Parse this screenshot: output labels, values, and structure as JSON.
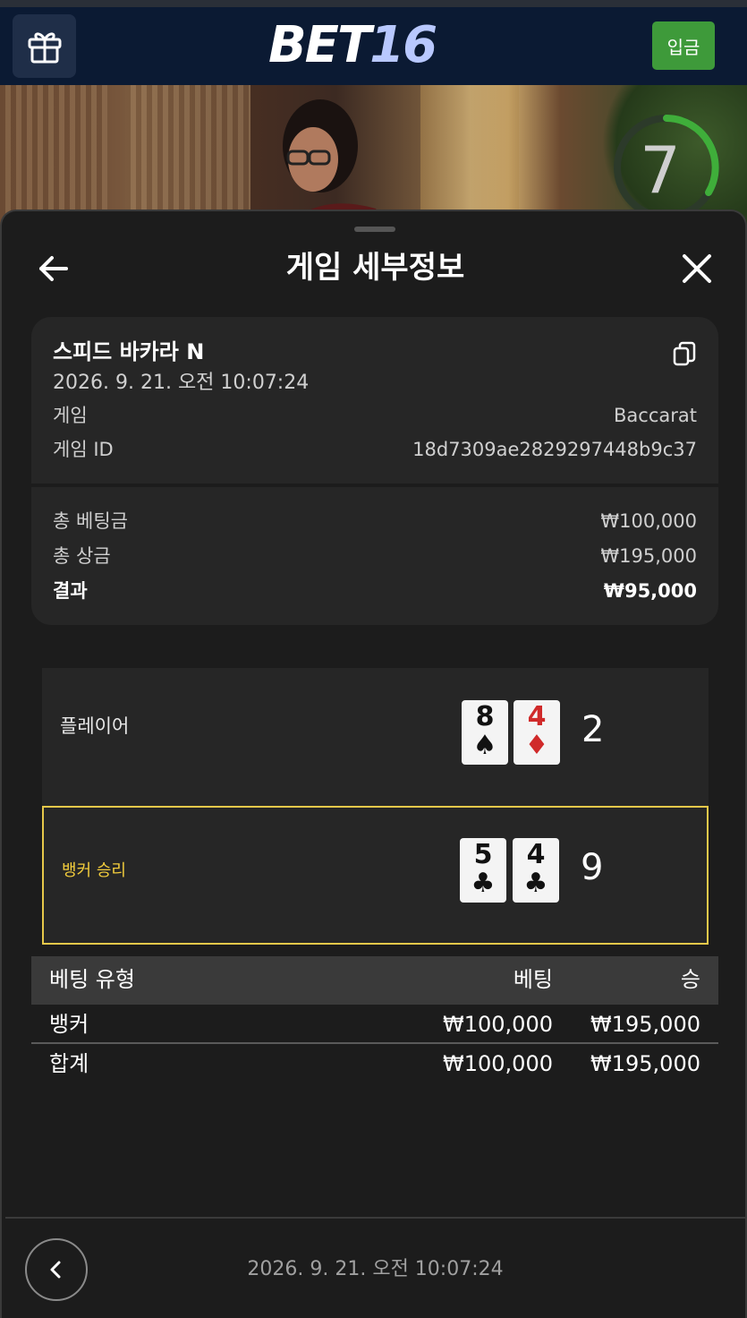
{
  "header": {
    "logo_part1": "BET",
    "logo_part2": "16",
    "deposit_label": "입금"
  },
  "stream": {
    "timer_value": "7",
    "timer_progress": 0.45
  },
  "sheet": {
    "title": "게임 세부정보"
  },
  "game": {
    "name": "스피드 바카라 N",
    "datetime": "2026. 9. 21. 오전 10:07:24",
    "type_label": "게임",
    "type_value": "Baccarat",
    "id_label": "게임 ID",
    "id_value": "18d7309ae2829297448b9c37"
  },
  "summary": {
    "total_bet_label": "총 베팅금",
    "total_bet_value": "₩100,000",
    "total_win_label": "총 상금",
    "total_win_value": "₩195,000",
    "result_label": "결과",
    "result_value": "₩95,000"
  },
  "hands": {
    "player": {
      "label": "플레이어",
      "cards": [
        {
          "rank": "8",
          "suit": "♠",
          "color": "#111111"
        },
        {
          "rank": "4",
          "suit": "♦",
          "color": "#d02a2a"
        }
      ],
      "score": "2"
    },
    "banker": {
      "label": "뱅커 승리",
      "cards": [
        {
          "rank": "5",
          "suit": "♣",
          "color": "#111111"
        },
        {
          "rank": "4",
          "suit": "♣",
          "color": "#111111"
        }
      ],
      "score": "9"
    }
  },
  "bets_table": {
    "headers": [
      "베팅 유형",
      "베팅",
      "승"
    ],
    "rows": [
      [
        "뱅커",
        "₩100,000",
        "₩195,000"
      ],
      [
        "합계",
        "₩100,000",
        "₩195,000"
      ]
    ]
  },
  "footer": {
    "datetime": "2026. 9. 21. 오전 10:07:24"
  },
  "colors": {
    "header_bg": "#0b1a33",
    "deposit_green": "#3e9a3a",
    "banker_highlight": "#e6c84a",
    "timer_green": "#3fae3a"
  }
}
